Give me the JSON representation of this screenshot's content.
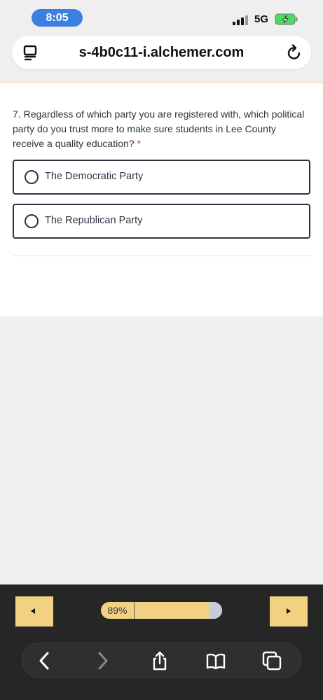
{
  "status": {
    "time": "8:05",
    "network": "5G"
  },
  "browser": {
    "url": "s-4b0c11-i.alchemer.com"
  },
  "survey": {
    "question_number": "7.",
    "question_text": "Regardless of which party you are registered with, which political party do you trust more to make sure students in Lee County receive a quality education?",
    "required_marker": "*",
    "options": [
      {
        "label": "The Democratic Party",
        "selected": false
      },
      {
        "label": "The Republican Party",
        "selected": false
      }
    ]
  },
  "navigation": {
    "progress_label": "89%",
    "progress_fraction": 0.89,
    "prev_icon": "triangle-left-icon",
    "next_icon": "triangle-right-icon"
  },
  "toolbar": {
    "icons": [
      "back-icon",
      "forward-icon",
      "share-icon",
      "bookmarks-icon",
      "tabs-icon"
    ]
  },
  "colors": {
    "accent_blue": "#3b7fe0",
    "nav_yellow": "#f2d282",
    "required_red": "#c0392b",
    "dark_bg": "#262626"
  }
}
